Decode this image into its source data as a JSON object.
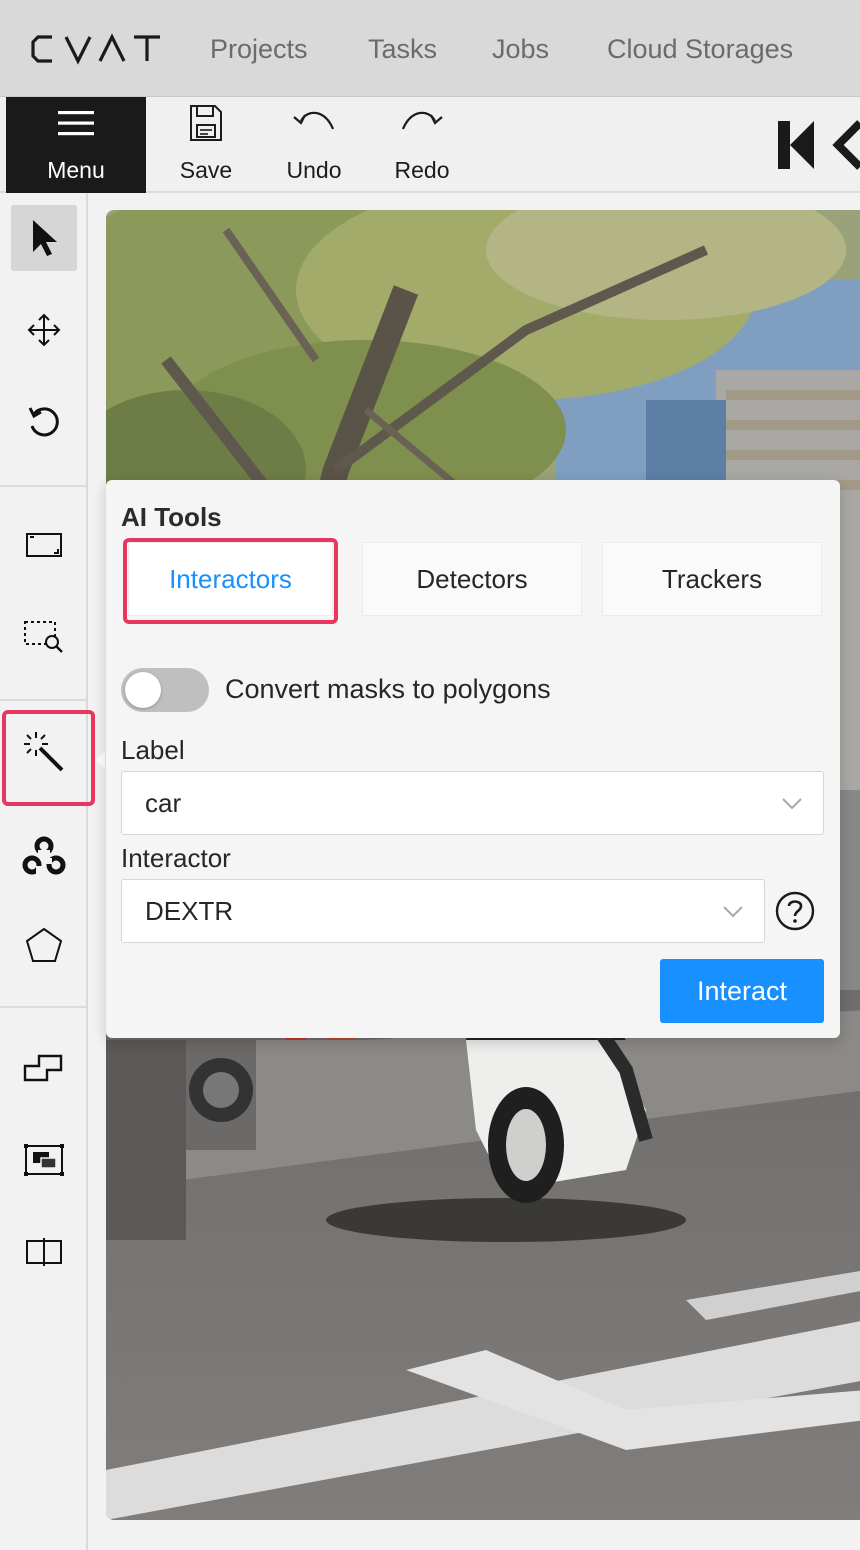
{
  "app": {
    "name": "CVAT"
  },
  "nav": {
    "links": [
      {
        "label": "Projects"
      },
      {
        "label": "Tasks"
      },
      {
        "label": "Jobs"
      },
      {
        "label": "Cloud Storages"
      }
    ]
  },
  "toolbar": {
    "menu_label": "Menu",
    "save_label": "Save",
    "undo_label": "Undo",
    "redo_label": "Redo"
  },
  "sidebar": {
    "tools": [
      {
        "name": "cursor",
        "icon": "cursor-icon",
        "active": true
      },
      {
        "name": "move",
        "icon": "move-icon"
      },
      {
        "name": "rotate",
        "icon": "rotate-icon"
      },
      {
        "name": "fit",
        "icon": "fit-image-icon"
      },
      {
        "name": "zoom-region",
        "icon": "zoom-region-icon"
      },
      {
        "name": "ai-tools",
        "icon": "magic-wand-icon",
        "highlighted": true
      },
      {
        "name": "opencv",
        "icon": "opencv-icon"
      },
      {
        "name": "polygon",
        "icon": "polygon-icon"
      },
      {
        "name": "merge",
        "icon": "merge-icon"
      },
      {
        "name": "group",
        "icon": "group-icon"
      },
      {
        "name": "split",
        "icon": "split-icon"
      }
    ]
  },
  "ai_tools": {
    "title": "AI Tools",
    "tabs": [
      {
        "label": "Interactors",
        "active": true
      },
      {
        "label": "Detectors"
      },
      {
        "label": "Trackers"
      }
    ],
    "convert_masks": {
      "label": "Convert masks to polygons",
      "checked": false
    },
    "label_field": {
      "label": "Label",
      "value": "car"
    },
    "interactor_field": {
      "label": "Interactor",
      "value": "DEXTR"
    },
    "interact_button": "Interact"
  },
  "colors": {
    "accent": "#1890ff",
    "highlight": "#e8375f",
    "menu_bg": "#1a1a1a"
  }
}
